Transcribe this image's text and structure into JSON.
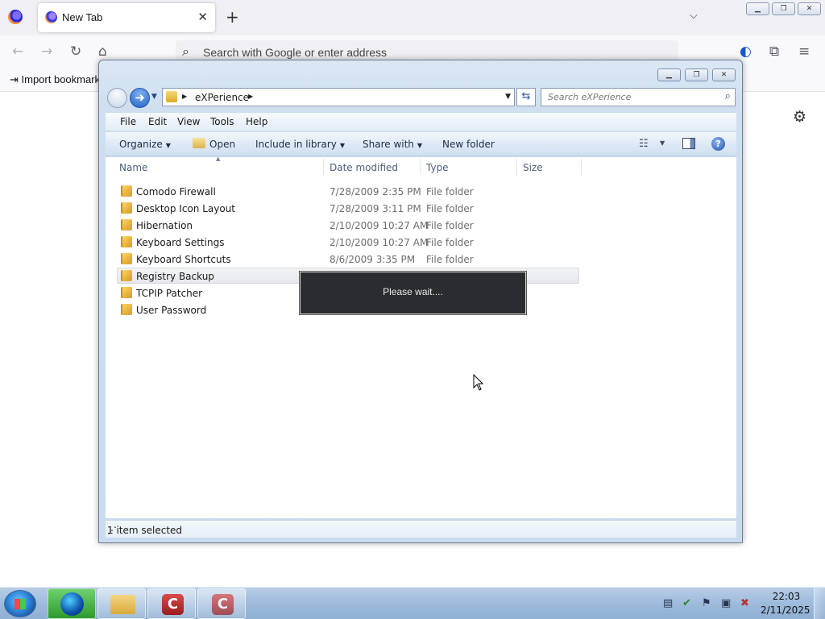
{
  "browser": {
    "tab_title": "New Tab",
    "tab_close": "✕",
    "new_tab": "+",
    "tab_list": "⌵",
    "url_placeholder": "Search with Google or enter address",
    "import_bookmarks": "Import bookmark",
    "window_controls": {
      "min": "▁",
      "max": "❐",
      "close": "✕"
    }
  },
  "explorer": {
    "breadcrumb_folder": "eXPerience",
    "search_placeholder": "Search eXPerience",
    "menu": [
      "File",
      "Edit",
      "View",
      "Tools",
      "Help"
    ],
    "commands": {
      "organize": "Organize",
      "open": "Open",
      "include": "Include in library",
      "share": "Share with",
      "new_folder": "New folder"
    },
    "columns": {
      "name": "Name",
      "date": "Date modified",
      "type": "Type",
      "size": "Size"
    },
    "rows": [
      {
        "name": "Comodo Firewall",
        "date": "7/28/2009 2:35 PM",
        "type": "File folder"
      },
      {
        "name": "Desktop Icon Layout",
        "date": "7/28/2009 3:11 PM",
        "type": "File folder"
      },
      {
        "name": "Hibernation",
        "date": "2/10/2009 10:27 AM",
        "type": "File folder"
      },
      {
        "name": "Keyboard Settings",
        "date": "2/10/2009 10:27 AM",
        "type": "File folder"
      },
      {
        "name": "Keyboard Shortcuts",
        "date": "8/6/2009 3:35 PM",
        "type": "File folder"
      },
      {
        "name": "Registry Backup",
        "date": "",
        "type": ""
      },
      {
        "name": "TCPIP Patcher",
        "date": "",
        "type": ""
      },
      {
        "name": "User Password",
        "date": "",
        "type": ""
      }
    ],
    "wait_message": "Please wait....",
    "status": "1 item selected"
  },
  "taskbar": {
    "clock_time": "22:03",
    "clock_date": "2/11/2025"
  }
}
